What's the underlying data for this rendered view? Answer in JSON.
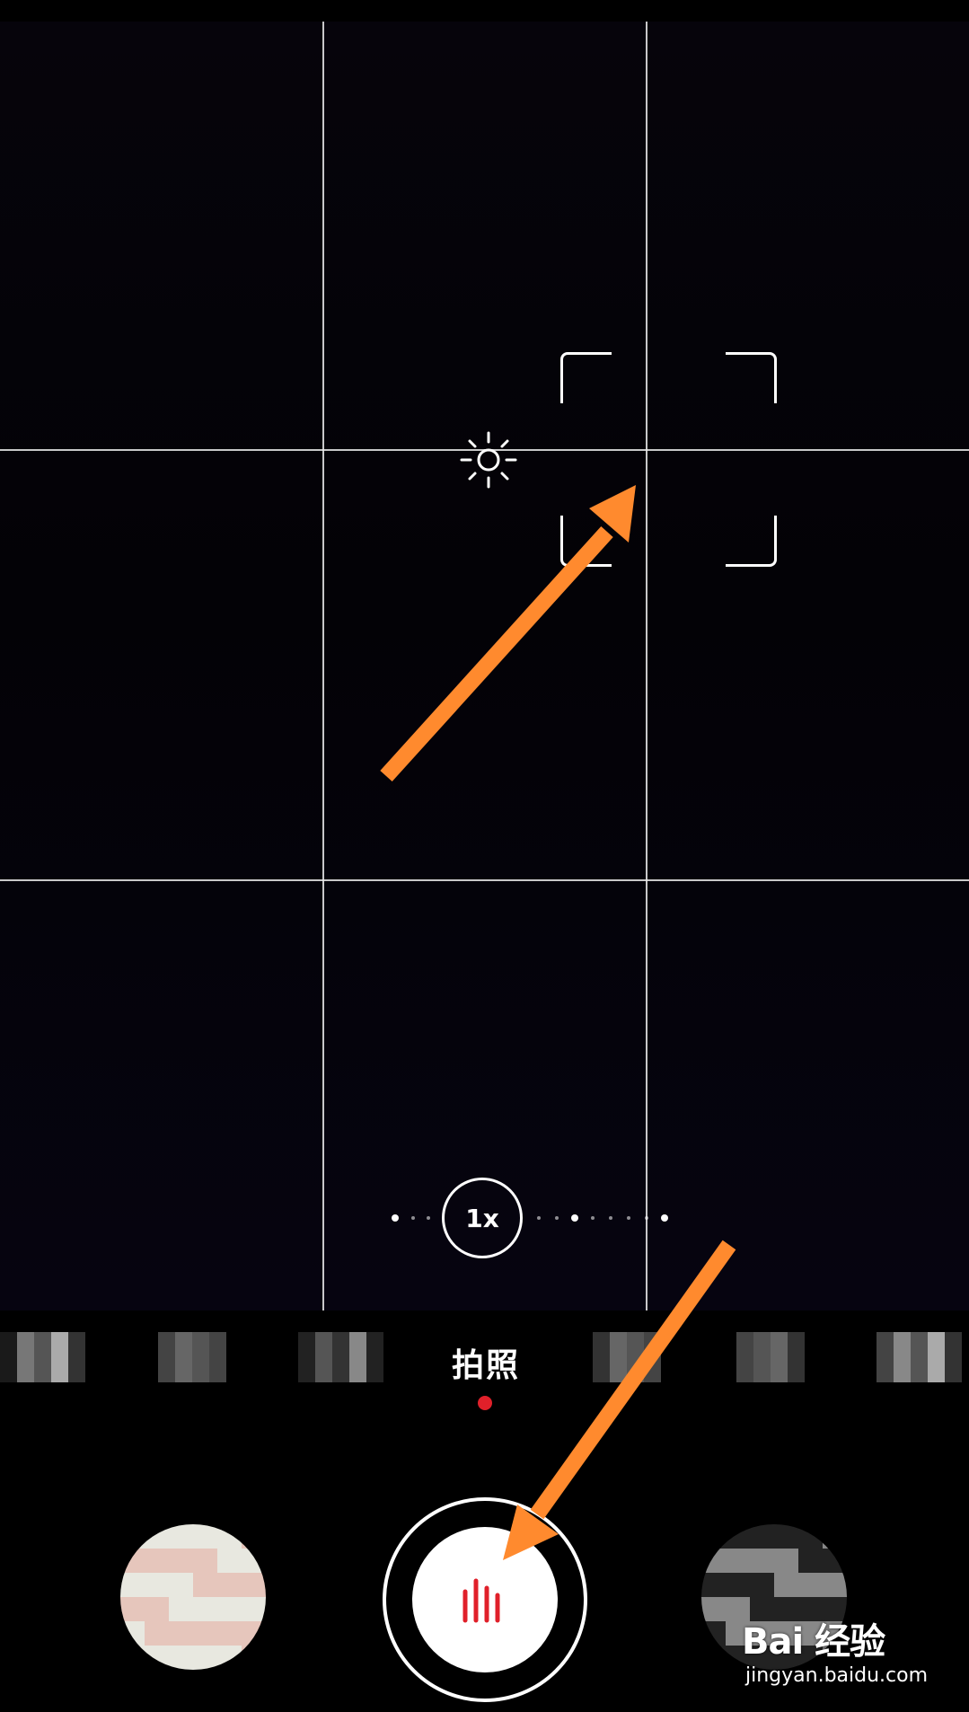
{
  "viewfinder": {
    "zoom_label": "1x"
  },
  "modes": {
    "current": "拍照"
  },
  "controls": {
    "shutter_icon": "audio-bars-icon",
    "gallery_icon": "gallery-thumbnail",
    "switch_icon": "switch-camera-icon"
  },
  "watermark": {
    "logo": "Bai 经验",
    "sub": "jingyan.baidu.com"
  },
  "colors": {
    "accent_red": "#e0202a",
    "annotation_orange": "#ff8a2e",
    "grid_line": "#ebebeb"
  }
}
